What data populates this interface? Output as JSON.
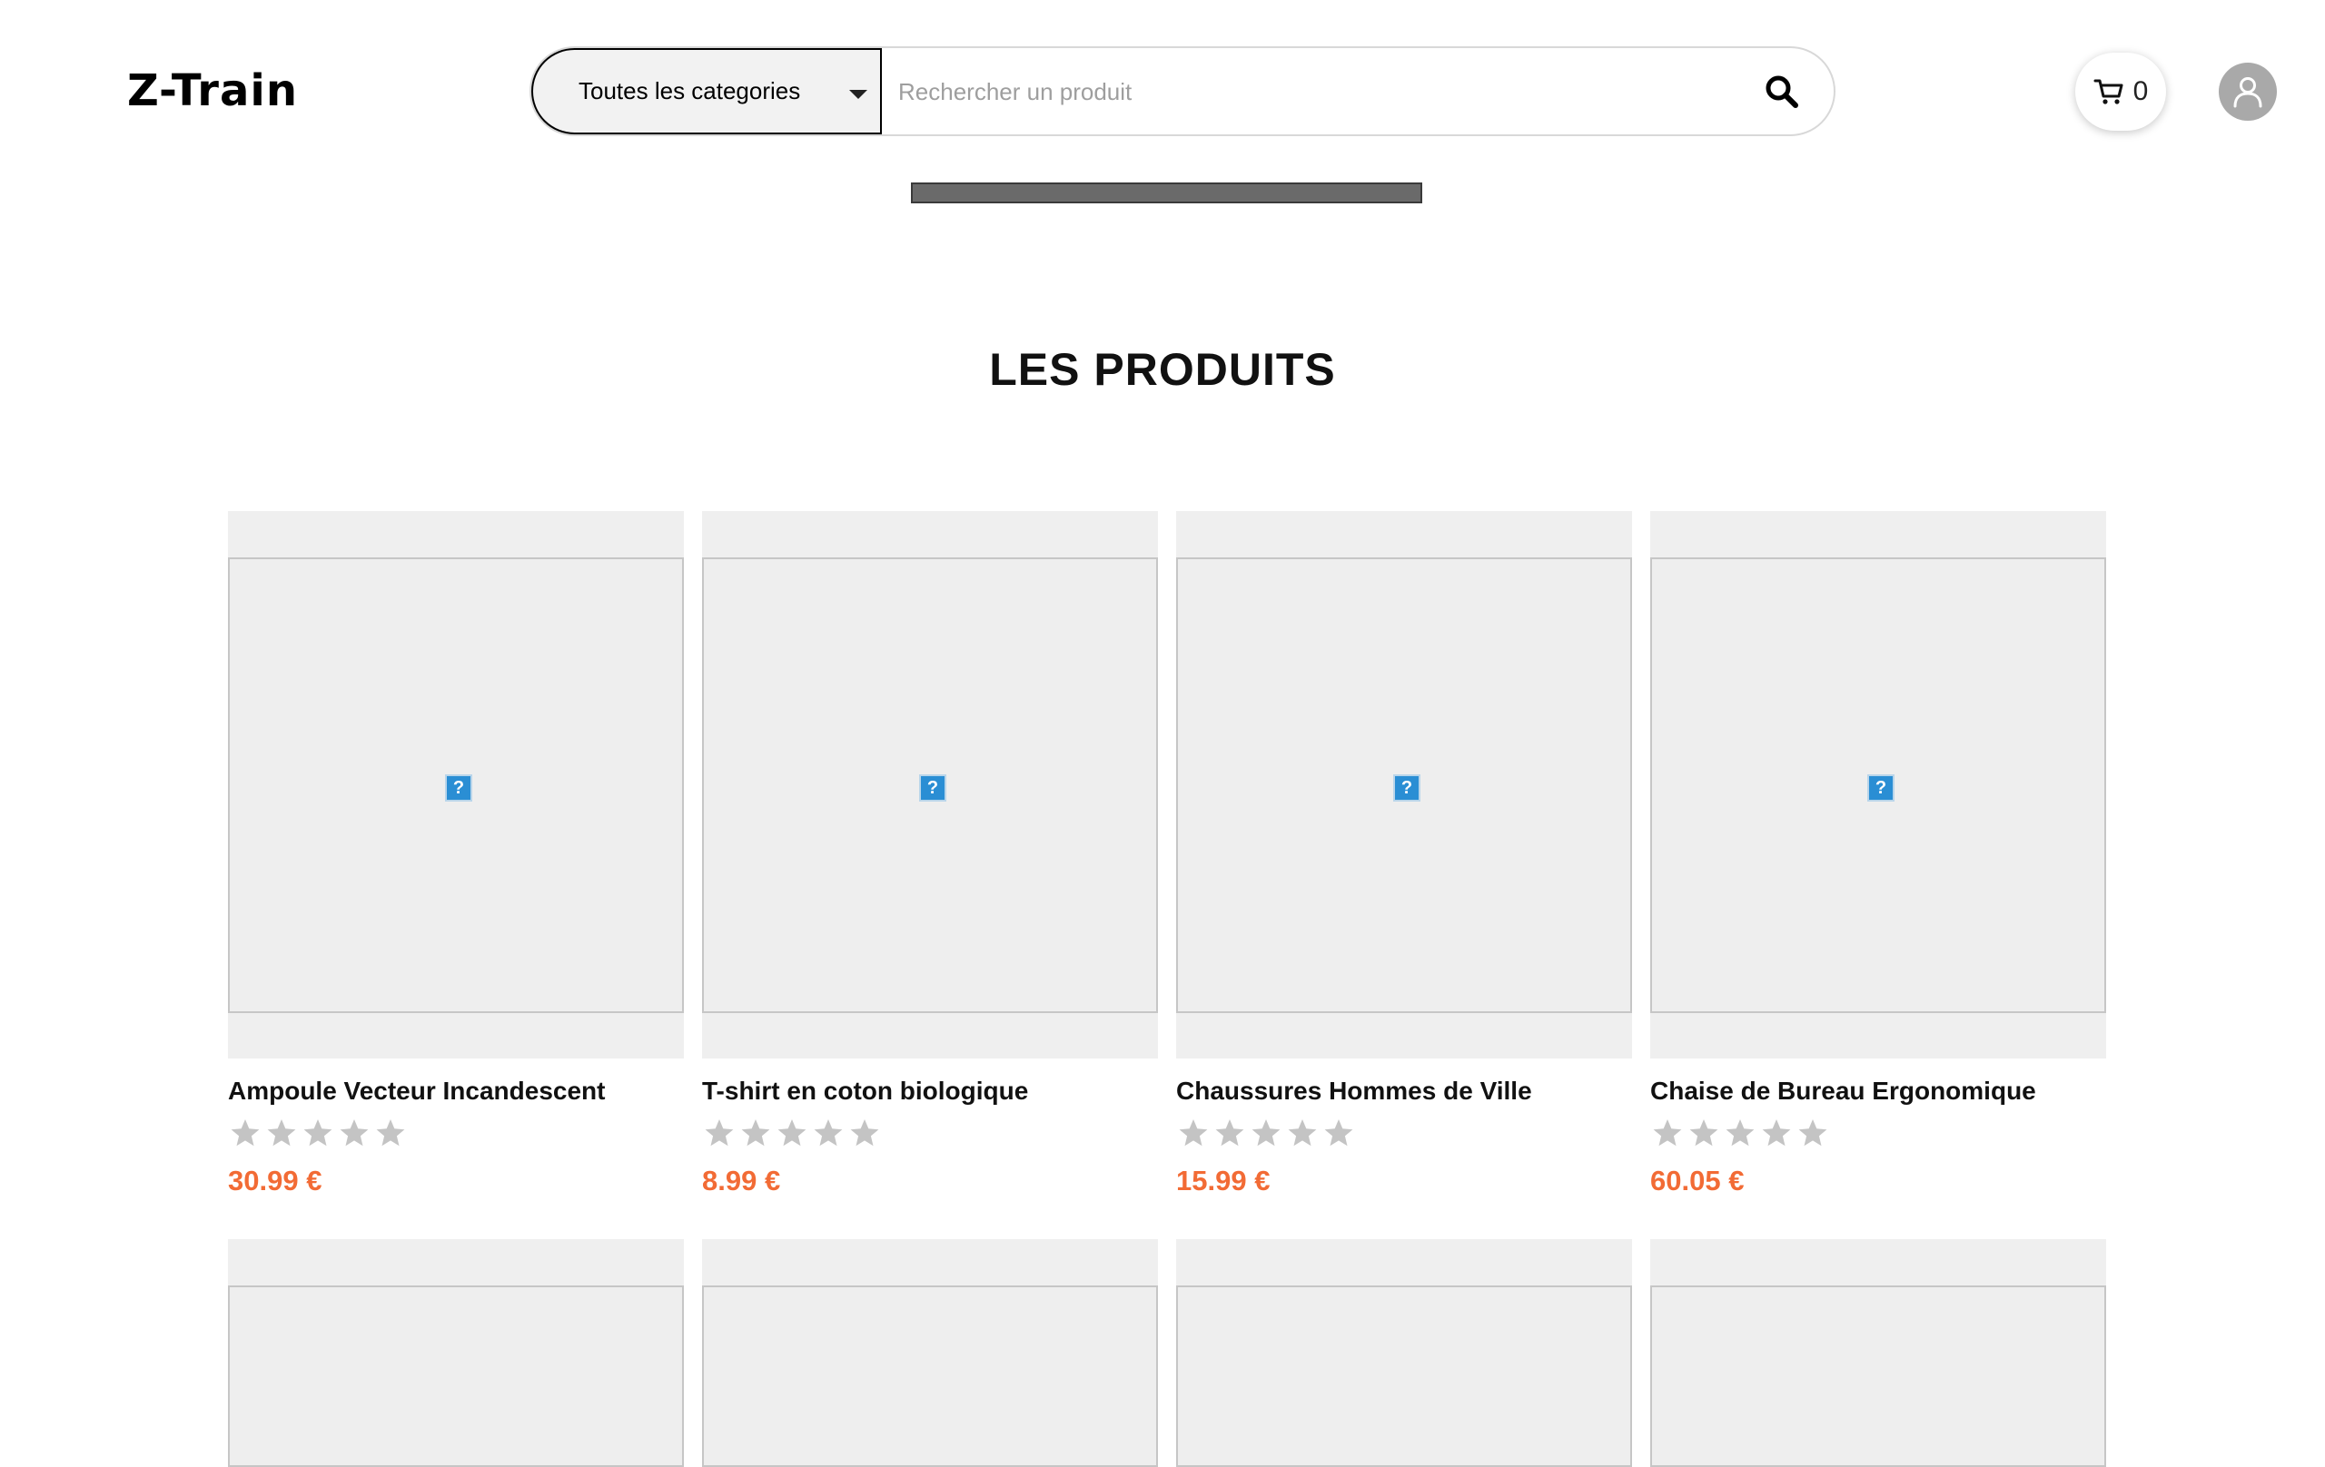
{
  "header": {
    "logo": "Z-Train",
    "category_select": {
      "selected": "Toutes les categories"
    },
    "search": {
      "placeholder": "Rechercher un produit",
      "value": ""
    },
    "cart": {
      "count": "0"
    }
  },
  "section": {
    "title": "LES PRODUITS"
  },
  "products": [
    {
      "name": "Ampoule Vecteur Incandescent",
      "price": "30.99 €",
      "rating": 0,
      "image_placeholder": "?"
    },
    {
      "name": "T-shirt en coton biologique",
      "price": "8.99 €",
      "rating": 0,
      "image_placeholder": "?"
    },
    {
      "name": "Chaussures Hommes de Ville",
      "price": "15.99 €",
      "rating": 0,
      "image_placeholder": "?"
    },
    {
      "name": "Chaise de Bureau Ergonomique",
      "price": "60.05 €",
      "rating": 0,
      "image_placeholder": "?"
    }
  ],
  "colors": {
    "price": "#f26b35",
    "star_empty": "#c4c4c4",
    "card_bg": "#efefef",
    "avatar_bg": "#a9a9a9",
    "dark_bar": "#6a6a6a"
  },
  "icons": {
    "search": "search-icon",
    "cart": "cart-icon",
    "user": "user-icon",
    "caret": "chevron-down-icon",
    "star": "star-icon",
    "broken_image": "broken-image-icon"
  }
}
